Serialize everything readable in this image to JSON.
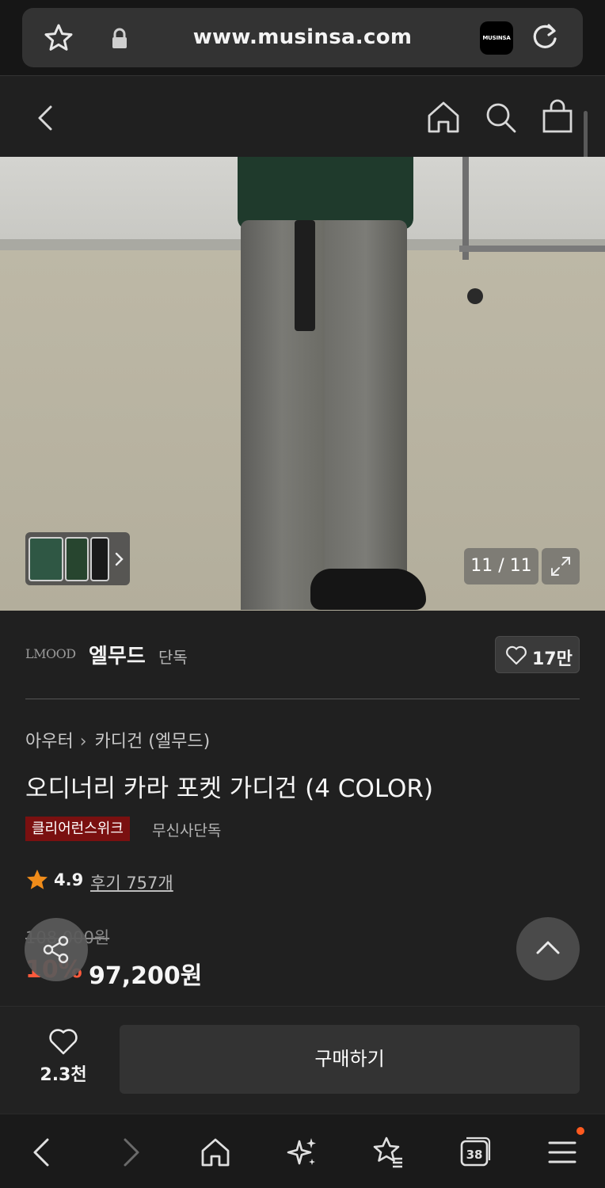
{
  "browser": {
    "url": "www.musinsa.com",
    "site_icon_text": "MUSINSA",
    "tab_count": "38"
  },
  "gallery": {
    "counter": "11 / 11"
  },
  "brand": {
    "logo_text": "LMOOD",
    "name": "엘무드",
    "tag": "단독",
    "likes": "17만"
  },
  "product": {
    "breadcrumb": [
      "아우터",
      "카디건 (엘무드)"
    ],
    "title": "오디너리 카라 포켓 가디건 (4 COLOR)",
    "badge_sale": "클리어런스위크",
    "badge_exclusive": "무신사단독",
    "rating": "4.9",
    "review_label": "후기 757개",
    "original_price": "108,000원",
    "discount": "10%",
    "price": "97,200원"
  },
  "actions": {
    "wish_count": "2.3천",
    "buy_label": "구매하기"
  },
  "colors": {
    "accent_discount": "#ff5a3c",
    "sale_badge": "#7a1010",
    "notification_dot": "#ff5a1f",
    "star": "#f08c1a"
  }
}
